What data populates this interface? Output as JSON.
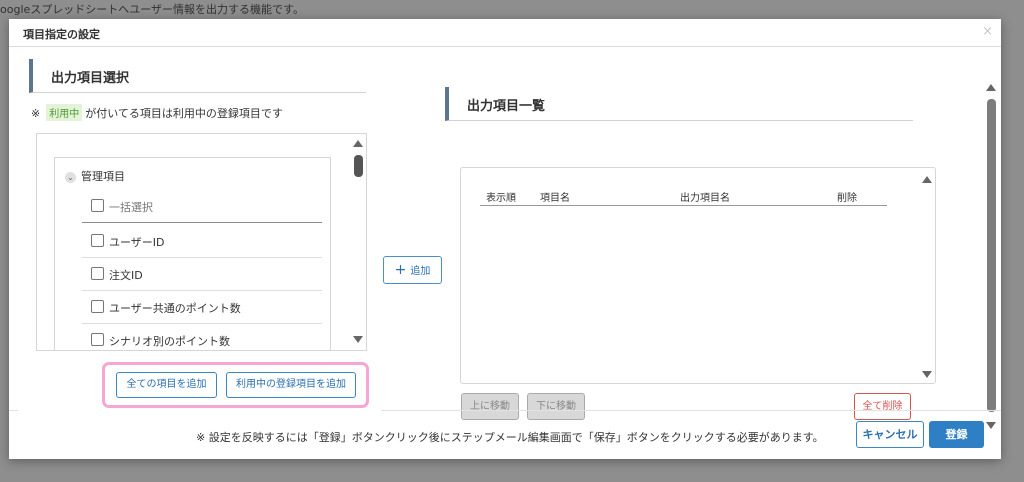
{
  "background": {
    "description": "oogleスプレッドシートへユーザー情報を出力する機能です。"
  },
  "modal": {
    "title": "項目指定の設定",
    "close_glyph": "×"
  },
  "left": {
    "header": "出力項目選択",
    "note_mark": "※",
    "tag_label": "利用中",
    "note_text": "が付いてる項目は利用中の登録項目です",
    "group_title": "管理項目",
    "group_chevron": "⌄",
    "items": [
      {
        "label": "一括選択"
      },
      {
        "label": "ユーザーID"
      },
      {
        "label": "注文ID"
      },
      {
        "label": "ユーザー共通のポイント数"
      },
      {
        "label": "シナリオ別のポイント数"
      }
    ],
    "add_all_label": "全ての項目を追加",
    "add_inuse_label": "利用中の登録項目を追加"
  },
  "add_button": {
    "icon": "+",
    "label": "追加"
  },
  "right": {
    "header": "出力項目一覧",
    "columns": [
      "表示順",
      "項目名",
      "出力項目名",
      "削除"
    ],
    "move_up_label": "上に移動",
    "move_down_label": "下に移動",
    "delete_all_label": "全て削除"
  },
  "footer": {
    "note": "※ 設定を反映するには「登録」ボタンクリック後にステップメール編集画面で「保存」ボタンをクリックする必要があります。",
    "cancel_label": "キャンセル",
    "register_label": "登録"
  },
  "colors": {
    "accent": "#2f7fc4",
    "highlight": "#f7a6d4",
    "danger": "#d9534f",
    "tag_bg": "#e3f3d8",
    "tag_text": "#4f9a31"
  }
}
